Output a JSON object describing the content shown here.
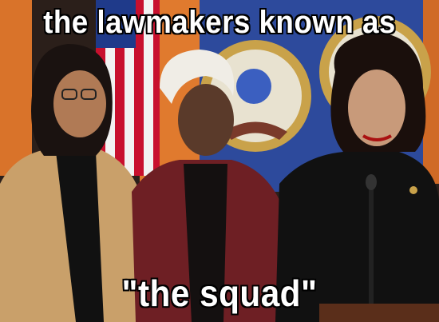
{
  "caption": {
    "top": "the lawmakers known as",
    "bottom": "\"the squad\""
  },
  "colors": {
    "flag_red": "#c8102e",
    "flag_blue": "#1f3a8a",
    "seal_blue": "#2d4a9c",
    "seal_gold": "#c9a24a",
    "curtain_orange": "#e07a2e",
    "jacket_tan": "#c9a06a",
    "jacket_maroon": "#6e1f24",
    "black": "#111111"
  },
  "icons": [
    "house-seal-icon",
    "american-flag-icon",
    "microphone-icon"
  ]
}
